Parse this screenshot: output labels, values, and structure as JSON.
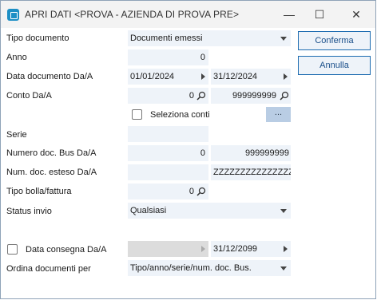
{
  "window": {
    "title": "APRI DATI <PROVA - AZIENDA DI PROVA PRE>",
    "minimize": "—",
    "maximize": "☐",
    "close": "✕"
  },
  "buttons": {
    "confirm": "Conferma",
    "cancel": "Annulla"
  },
  "form": {
    "tipo_documento": {
      "label": "Tipo documento",
      "value": "Documenti emessi"
    },
    "anno": {
      "label": "Anno",
      "value": "0"
    },
    "data_documento": {
      "label": "Data documento Da/A",
      "from": "01/01/2024",
      "to": "31/12/2024"
    },
    "conto": {
      "label": "Conto Da/A",
      "from": "0",
      "to": "999999999"
    },
    "seleziona_conti": {
      "label": "Seleziona conti",
      "button": "...",
      "checked": false
    },
    "serie": {
      "label": "Serie",
      "value": ""
    },
    "numero_doc": {
      "label": "Numero doc. Bus Da/A",
      "from": "0",
      "to": "999999999"
    },
    "num_doc_esteso": {
      "label": "Num. doc. esteso Da/A",
      "from": "",
      "to": "ZZZZZZZZZZZZZZZZ"
    },
    "tipo_bolla": {
      "label": "Tipo bolla/fattura",
      "value": "0"
    },
    "status_invio": {
      "label": "Status invio",
      "value": "Qualsiasi"
    },
    "data_consegna": {
      "label": "Data consegna Da/A",
      "from": "",
      "to": "31/12/2099",
      "checked": false
    },
    "ordina": {
      "label": "Ordina documenti per",
      "value": "Tipo/anno/serie/num. doc. Bus."
    }
  }
}
